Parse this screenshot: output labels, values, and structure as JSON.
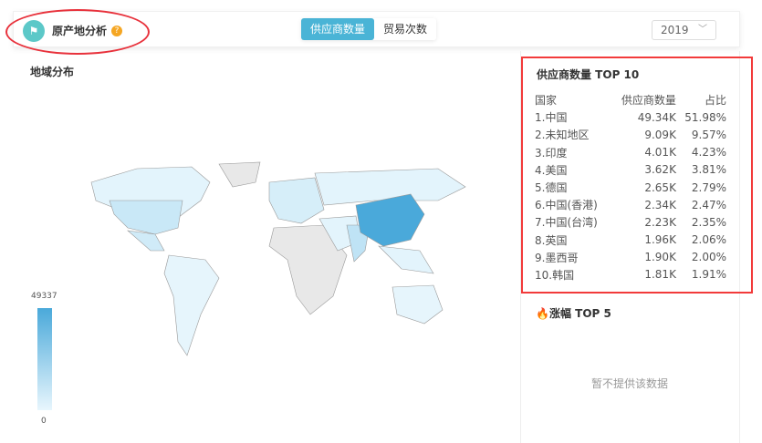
{
  "header": {
    "title": "原产地分析",
    "help_icon": "question-icon",
    "logo_icon": "flag-icon",
    "tabs": [
      {
        "label": "供应商数量",
        "active": true
      },
      {
        "label": "贸易次数",
        "active": false
      }
    ],
    "year": "2019"
  },
  "map": {
    "title": "地域分布",
    "legend_max": "49337",
    "legend_min": "0",
    "colors": {
      "high": "#4aa9da",
      "low": "#e8f6fd",
      "nodata": "#e8e8e8"
    }
  },
  "top10": {
    "title": "供应商数量 TOP 10",
    "columns": [
      "国家",
      "供应商数量",
      "占比"
    ],
    "rows": [
      [
        "1.中国",
        "49.34K",
        "51.98%"
      ],
      [
        "2.未知地区",
        "9.09K",
        "9.57%"
      ],
      [
        "3.印度",
        "4.01K",
        "4.23%"
      ],
      [
        "4.美国",
        "3.62K",
        "3.81%"
      ],
      [
        "5.德国",
        "2.65K",
        "2.79%"
      ],
      [
        "6.中国(香港)",
        "2.34K",
        "2.47%"
      ],
      [
        "7.中国(台湾)",
        "2.23K",
        "2.35%"
      ],
      [
        "8.英国",
        "1.96K",
        "2.06%"
      ],
      [
        "9.墨西哥",
        "1.90K",
        "2.00%"
      ],
      [
        "10.韩国",
        "1.81K",
        "1.91%"
      ]
    ]
  },
  "top5": {
    "title": "涨幅 TOP 5",
    "icon": "fire-icon",
    "empty": "暂不提供该数据"
  }
}
